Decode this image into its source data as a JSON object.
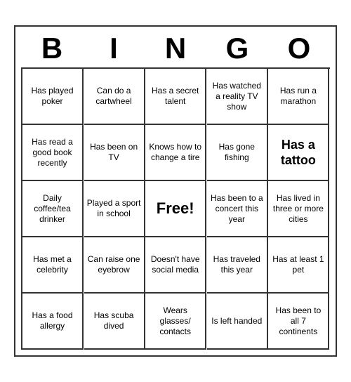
{
  "header": {
    "letters": [
      "B",
      "I",
      "N",
      "G",
      "O"
    ]
  },
  "cells": [
    {
      "id": "r0c0",
      "text": "Has played poker",
      "style": "normal"
    },
    {
      "id": "r0c1",
      "text": "Can do a cartwheel",
      "style": "normal"
    },
    {
      "id": "r0c2",
      "text": "Has a secret talent",
      "style": "normal"
    },
    {
      "id": "r0c3",
      "text": "Has watched a reality TV show",
      "style": "normal"
    },
    {
      "id": "r0c4",
      "text": "Has run a marathon",
      "style": "normal"
    },
    {
      "id": "r1c0",
      "text": "Has read a good book recently",
      "style": "normal"
    },
    {
      "id": "r1c1",
      "text": "Has been on TV",
      "style": "normal"
    },
    {
      "id": "r1c2",
      "text": "Knows how to change a tire",
      "style": "normal"
    },
    {
      "id": "r1c3",
      "text": "Has gone fishing",
      "style": "normal"
    },
    {
      "id": "r1c4",
      "text": "Has a tattoo",
      "style": "large"
    },
    {
      "id": "r2c0",
      "text": "Daily coffee/tea drinker",
      "style": "normal"
    },
    {
      "id": "r2c1",
      "text": "Played a sport in school",
      "style": "normal"
    },
    {
      "id": "r2c2",
      "text": "Free!",
      "style": "free"
    },
    {
      "id": "r2c3",
      "text": "Has been to a concert this year",
      "style": "normal"
    },
    {
      "id": "r2c4",
      "text": "Has lived in three or more cities",
      "style": "normal"
    },
    {
      "id": "r3c0",
      "text": "Has met a celebrity",
      "style": "normal"
    },
    {
      "id": "r3c1",
      "text": "Can raise one eyebrow",
      "style": "normal"
    },
    {
      "id": "r3c2",
      "text": "Doesn't have social media",
      "style": "normal"
    },
    {
      "id": "r3c3",
      "text": "Has traveled this year",
      "style": "normal"
    },
    {
      "id": "r3c4",
      "text": "Has at least 1 pet",
      "style": "normal"
    },
    {
      "id": "r4c0",
      "text": "Has a food allergy",
      "style": "normal"
    },
    {
      "id": "r4c1",
      "text": "Has scuba dived",
      "style": "normal"
    },
    {
      "id": "r4c2",
      "text": "Wears glasses/ contacts",
      "style": "normal"
    },
    {
      "id": "r4c3",
      "text": "Is left handed",
      "style": "normal"
    },
    {
      "id": "r4c4",
      "text": "Has been to all 7 continents",
      "style": "normal"
    }
  ]
}
